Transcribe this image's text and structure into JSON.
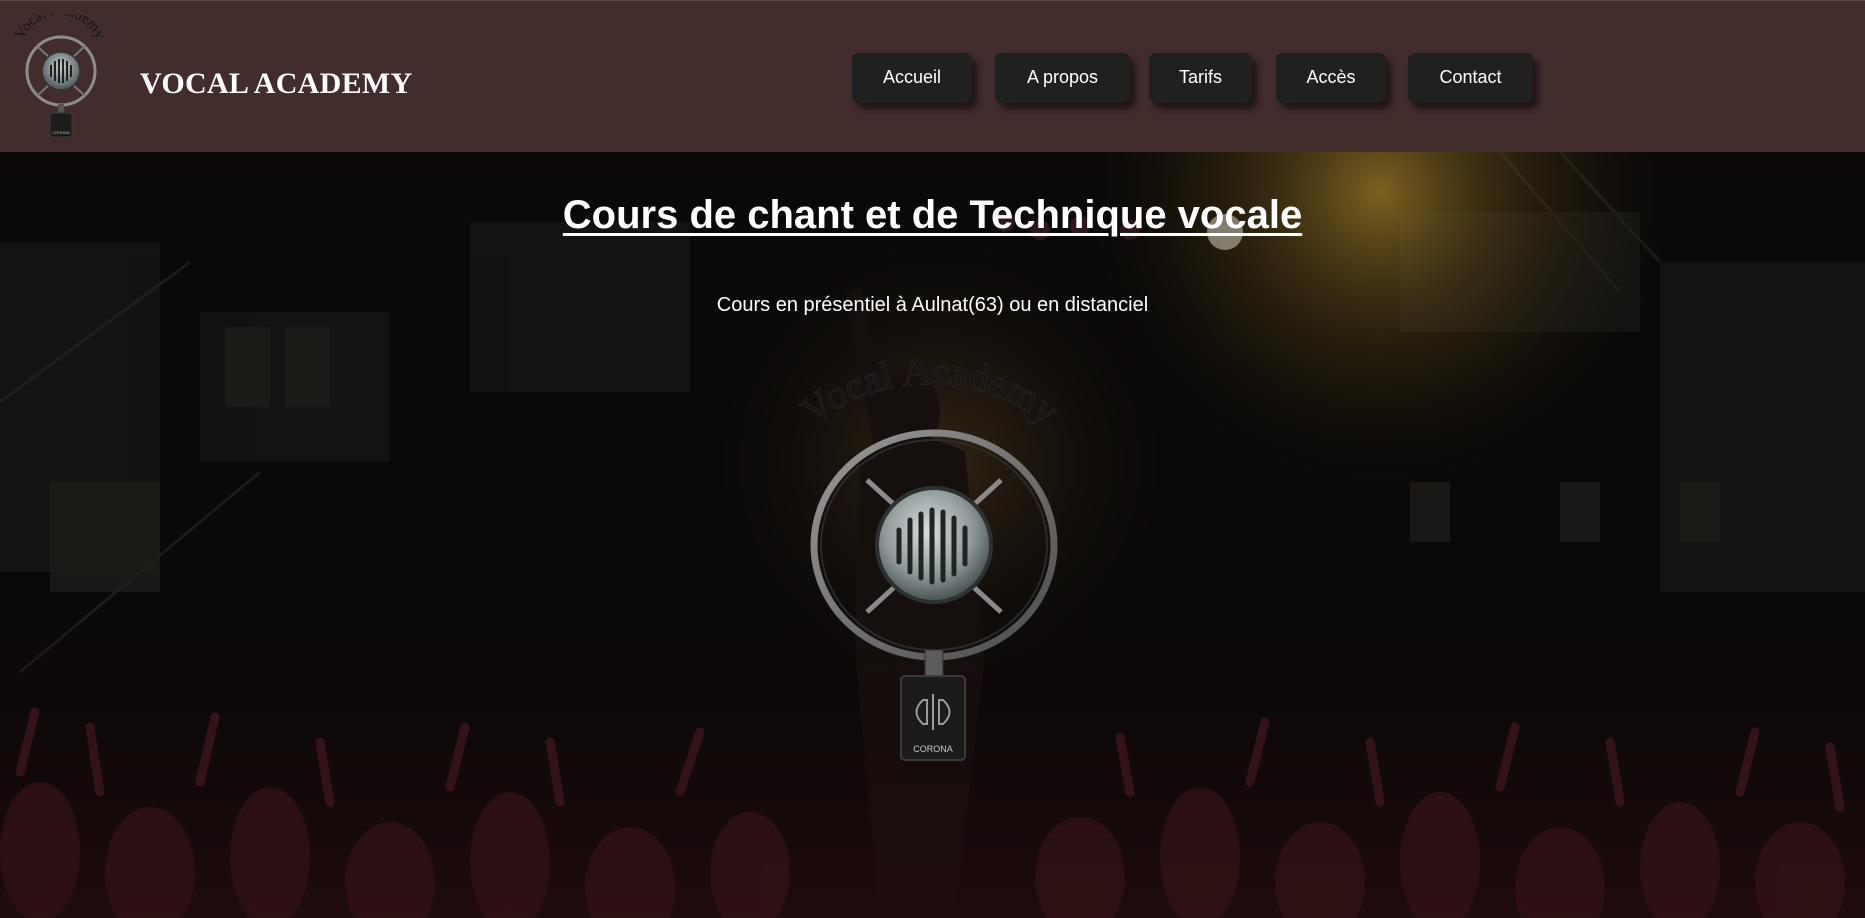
{
  "header": {
    "logo_icon": "vocal-academy-microphone-logo",
    "site_title": "VOCAL ACADEMY",
    "background_color": "#422c2c"
  },
  "nav": {
    "items": [
      {
        "label": "Accueil"
      },
      {
        "label": "A propos"
      },
      {
        "label": "Tarifs"
      },
      {
        "label": "Accès"
      },
      {
        "label": "Contact"
      }
    ],
    "button_color": "#202020"
  },
  "hero": {
    "title": "Cours de chant et de Technique vocale",
    "subtitle": "Cours en présentiel à Aulnat(63) ou en distanciel",
    "background_image": "concert-singer-crowd-dark",
    "logo": {
      "icon": "vintage-microphone-logo",
      "arc_text": "Vocal Academy",
      "badge_text": "CORONA"
    }
  }
}
